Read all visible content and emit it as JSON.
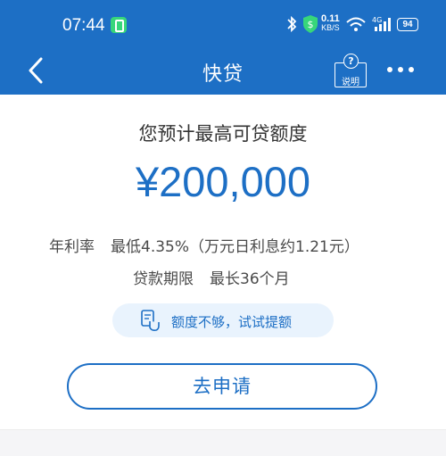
{
  "status_bar": {
    "time": "07:44",
    "net_speed_value": "0.11",
    "net_speed_unit": "KB/S",
    "network": "4G",
    "battery": "94"
  },
  "app_bar": {
    "title": "快贷",
    "help_label": "说明",
    "help_icon": "?"
  },
  "loan": {
    "heading": "您预计最高可贷额度",
    "amount": "¥200,000",
    "rate_label": "年利率",
    "rate_value": "最低4.35%（万元日利息约1.21元）",
    "term_label": "贷款期限",
    "term_value": "最长36个月"
  },
  "tip": {
    "text": "额度不够，试试提额",
    "icon": "hand-document-icon"
  },
  "apply_button": {
    "label": "去申请"
  },
  "colors": {
    "primary": "#1d6fc5",
    "tip_bg": "#e9f3fd",
    "text_dark": "#333333",
    "status_green": "#37d67a"
  }
}
